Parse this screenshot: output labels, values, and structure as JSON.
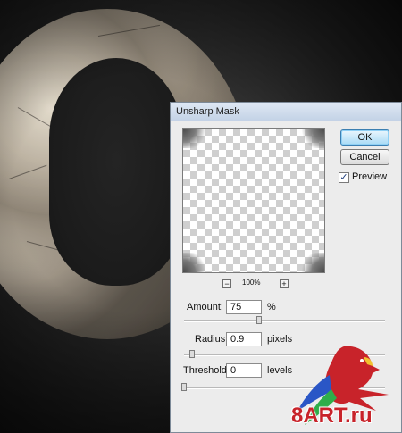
{
  "dialog": {
    "title": "Unsharp Mask",
    "ok_label": "OK",
    "cancel_label": "Cancel",
    "preview_label": "Preview",
    "preview_checked": "✓",
    "zoom_minus": "−",
    "zoom_plus": "+",
    "zoom_level": "100%",
    "amount": {
      "label": "Amount:",
      "value": "75",
      "unit": "%",
      "slider_fraction": 0.375
    },
    "radius": {
      "label": "Radius:",
      "value": "0.9",
      "unit": "pixels",
      "slider_fraction": 0.04
    },
    "threshold": {
      "label": "Threshold:",
      "value": "0",
      "unit": "levels",
      "slider_fraction": 0.0
    }
  },
  "watermark": {
    "text": "8ART.ru"
  },
  "colors": {
    "ok_accent": "#3c7fb1",
    "watermark_red": "#c8232a",
    "parrot_blue": "#2a56c6",
    "parrot_green": "#2fae4a"
  }
}
